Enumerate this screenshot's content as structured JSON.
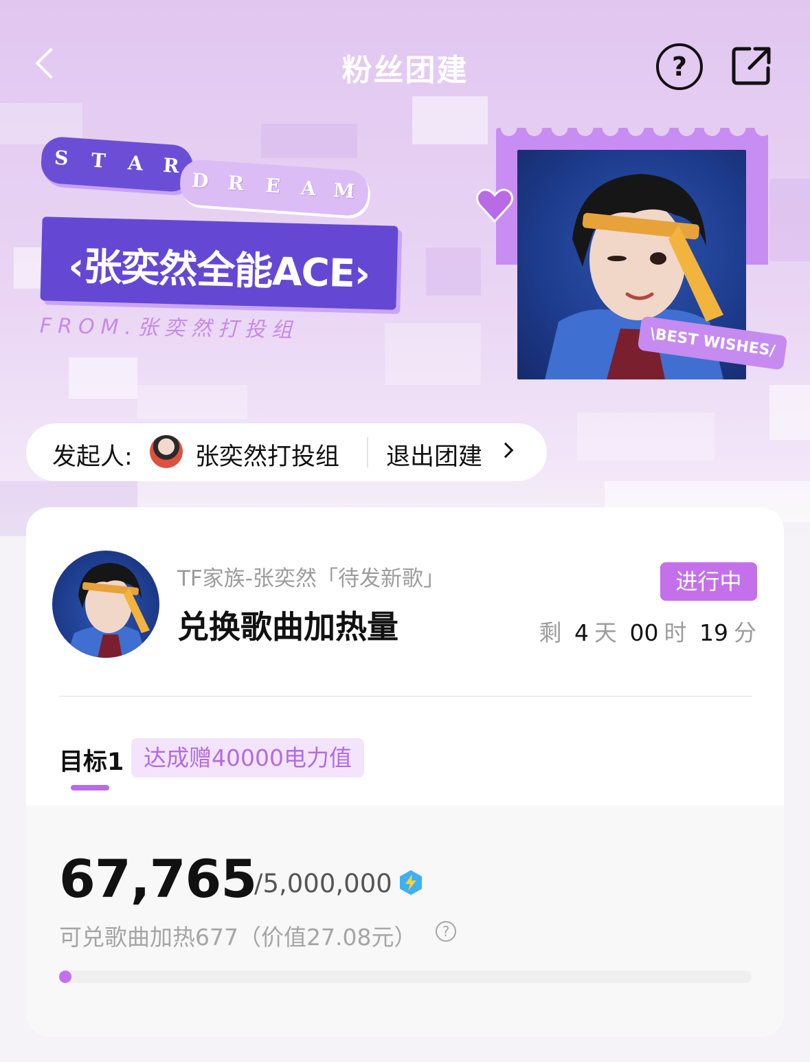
{
  "header": {
    "title": "粉丝团建",
    "back_icon": "chevron-left-icon",
    "help_icon": "question-circle-icon",
    "share_icon": "share-external-icon"
  },
  "hero": {
    "star_word": "STAR",
    "dream_word": "DREAM",
    "banner_title": "‹张奕然全能ACE›",
    "from_text": "FROM.张奕然打投组",
    "stamp_tag": "\\BEST WISHES/",
    "heart_icon": "heart-icon"
  },
  "initiator": {
    "label": "发起人:",
    "name": "张奕然打投组",
    "exit_label": "退出团建"
  },
  "task": {
    "subtitle": "TF家族-张奕然「待发新歌」",
    "title": "兑换歌曲加热量",
    "status": "进行中",
    "countdown": {
      "prefix": "剩",
      "days": "4",
      "day_unit": "天",
      "hours": "00",
      "hour_unit": "时",
      "minutes": "19",
      "minute_unit": "分"
    }
  },
  "goal": {
    "tab_label": "目标1",
    "reward": "达成赠40000电力值",
    "current": "67,765",
    "target": "/5,000,000",
    "progress_fraction": 0.0136,
    "redeem_text": "可兑歌曲加热677（价值27.08元）",
    "info_icon": "question-circle-icon",
    "power_icon": "lightning-badge-icon"
  },
  "colors": {
    "accent": "#c470ea",
    "banner": "#6448d4",
    "hero_bg": "#e0c4f0"
  }
}
